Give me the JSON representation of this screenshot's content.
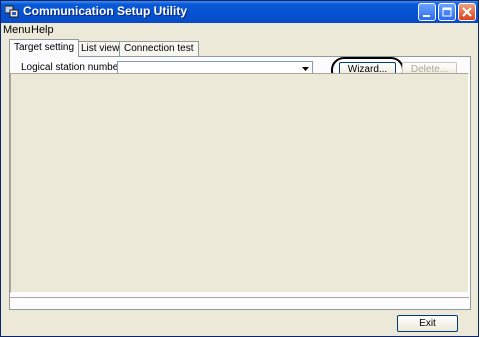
{
  "window": {
    "title": "Communication Setup Utility"
  },
  "menu": {
    "items": [
      "Menu",
      "Help"
    ]
  },
  "tabs": [
    {
      "label": "Target setting",
      "active": true
    },
    {
      "label": "List view",
      "active": false
    },
    {
      "label": "Connection test",
      "active": false
    }
  ],
  "form": {
    "logical_station_label": "Logical station number",
    "logical_station_value": "",
    "wizard_label": "Wizard...",
    "delete_label": "Delete..."
  },
  "footer": {
    "exit_label": "Exit"
  },
  "icons": {
    "app": "app-icon",
    "minimize": "minimize-icon",
    "maximize": "maximize-icon",
    "close": "close-icon",
    "dropdown": "chevron-down-icon"
  },
  "colors": {
    "titlebar": "#0a5ad8",
    "window_bg": "#ece9d8",
    "close_button": "#d8431c"
  }
}
